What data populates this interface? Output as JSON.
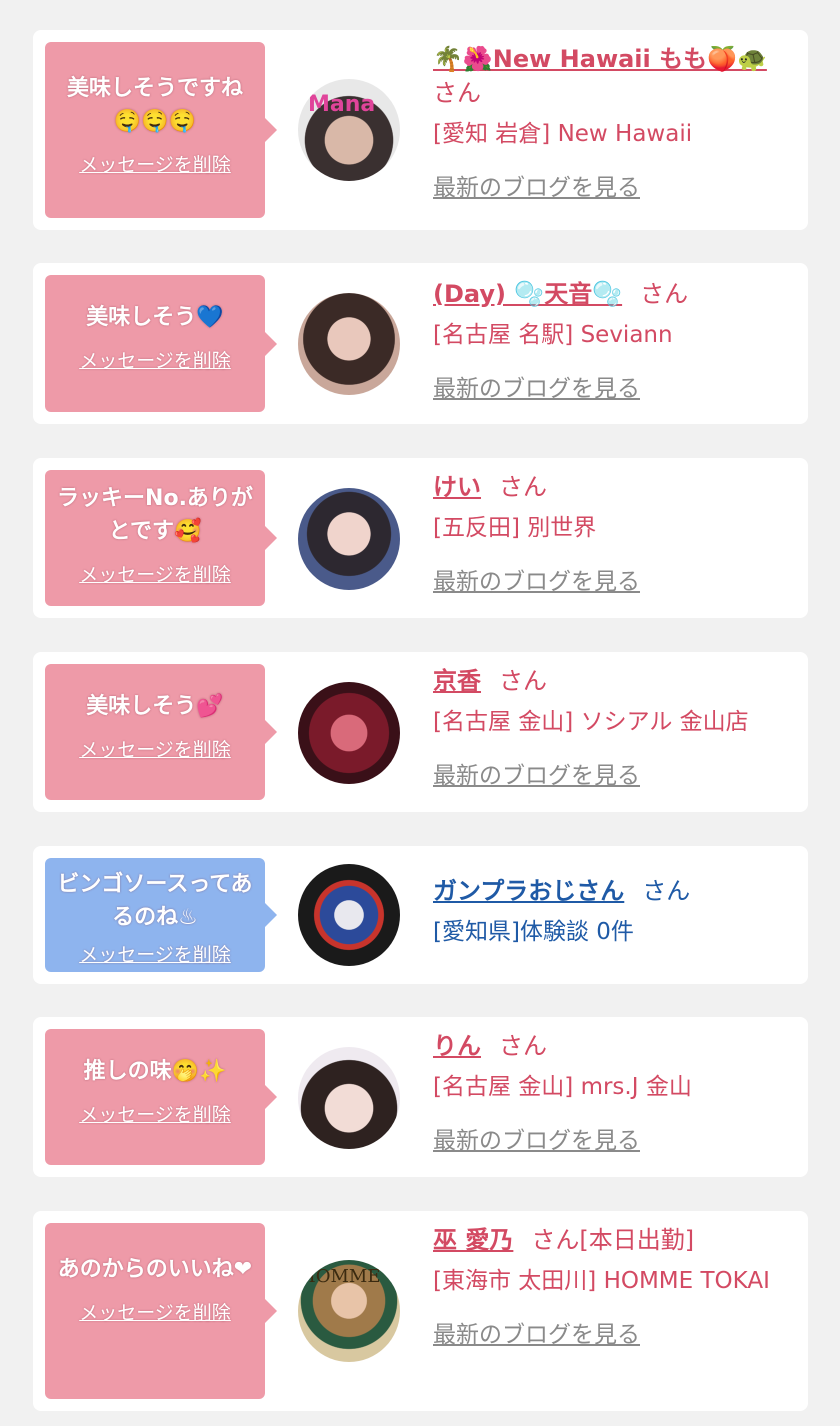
{
  "delete_label": "メッセージを削除",
  "blog_label": "最新のブログを見る",
  "san_label": "さん",
  "items": [
    {
      "message": "美味しそうですね🤤🤤🤤",
      "name": "🌴🌺New Hawaii もも🍑🐢",
      "suffix": "",
      "shop": "[愛知 岩倉] New Hawaii",
      "bubble_color": "#ee9aa8",
      "has_blog": true
    },
    {
      "message": "美味しそう💙",
      "name": "(Day) 🫧天音🫧",
      "suffix": "",
      "shop": "[名古屋 名駅] Seviann",
      "bubble_color": "#ee9aa8",
      "has_blog": true
    },
    {
      "message": "ラッキーNo.ありがとです🥰",
      "name": "けい",
      "suffix": "",
      "shop": "[五反田] 別世界",
      "bubble_color": "#ee9aa8",
      "has_blog": true
    },
    {
      "message": "美味しそう💕",
      "name": "京香",
      "suffix": "",
      "shop": "[名古屋 金山] ソシアル 金山店",
      "bubble_color": "#ee9aa8",
      "has_blog": true
    },
    {
      "message": "ビンゴソースってあるのね♨",
      "name": "ガンプラおじさん",
      "suffix": "",
      "shop": "[愛知県]体験談 0件",
      "bubble_color": "#8eb4ee",
      "has_blog": false
    },
    {
      "message": "推しの味🤭✨",
      "name": "りん",
      "suffix": "",
      "shop": "[名古屋 金山] mrs.J 金山",
      "bubble_color": "#ee9aa8",
      "has_blog": true
    },
    {
      "message": "あのからのいいね❤",
      "name": "巫 愛乃",
      "suffix": "[本日出勤]",
      "shop": "[東海市 太田川] HOMME TOKAI",
      "bubble_color": "#ee9aa8",
      "has_blog": true
    }
  ]
}
